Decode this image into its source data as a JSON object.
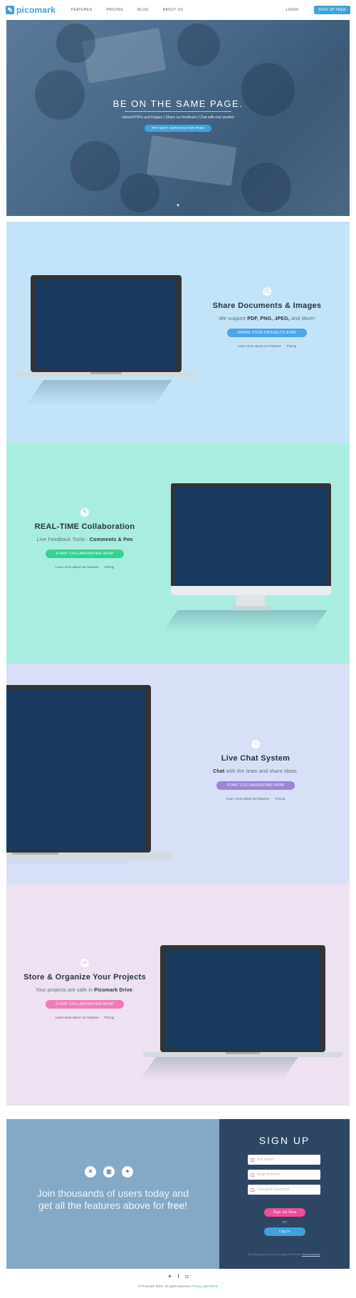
{
  "nav": {
    "logo_text": "picomark",
    "links": [
      "FEATURES",
      "PRICING",
      "BLOG",
      "ABOUT US"
    ],
    "login": "LOGIN",
    "signup": "SIGN UP FREE"
  },
  "hero": {
    "title": "BE ON THE SAME PAGE.",
    "subtitle": "Upload PDFs and Images | Share our feedback | Chat with one another",
    "button": "TRY BETA VERSION FOR FREE"
  },
  "sections": [
    {
      "title": "Share Documents & Images",
      "desc_prefix": "We support ",
      "desc_bold": "PDF, PNG, JPEG,",
      "desc_suffix": " and More!",
      "button": "SHARE YOUR PROJECTS NOW!",
      "button_color": "#4aa6e8",
      "link1": "Learn more about our features",
      "link2": "Pricing"
    },
    {
      "title": "REAL-TIME Collaboration",
      "desc_prefix": "Live Feedback Tools - ",
      "desc_bold": "Comments & Pen",
      "desc_suffix": "",
      "button": "START COLLABORATING NOW!",
      "button_color": "#35d190",
      "link1": "Learn more about our features",
      "link2": "Pricing"
    },
    {
      "title": "Live Chat System",
      "desc_prefix": "",
      "desc_bold": "Chat",
      "desc_suffix": " with the team and share ideas.",
      "button": "START COLLABORATING NOW!",
      "button_color": "#9b86d6",
      "link1": "Learn more about our features",
      "link2": "Pricing"
    },
    {
      "title": "Store & Organize Your Projects",
      "desc_prefix": "Your projects are safe in ",
      "desc_bold": "Picomark Drive",
      "desc_suffix": ".",
      "button": "START COLLABORATING NOW!",
      "button_color": "#f27ab8",
      "link1": "Learn more about our features",
      "link2": "Pricing"
    }
  ],
  "signup": {
    "join_line1": "Join thousands of users today and",
    "join_line2_prefix": "get all the features above for ",
    "join_line2_bold": "free",
    "join_line2_suffix": "!",
    "title": "SIGN UP",
    "full_name_placeholder": "Full Name",
    "email_placeholder": "Email Address",
    "password_placeholder": "Choose A Password",
    "signup_button": "Sign Up Now",
    "or": "OR",
    "login_button": "Log In",
    "terms_prefix": "By clicking Sign Up Now you agree to Picomark ",
    "terms_link": "Terms of Service"
  },
  "social_icons": [
    "close-icon",
    "book-icon",
    "bird-icon"
  ],
  "footer": {
    "icons": [
      "twitter-icon",
      "facebook-icon",
      "instagram-icon"
    ],
    "copyright_prefix": "© Picomark 2015. All rights reserved. ",
    "privacy": "Privacy",
    "and": " and ",
    "terms": "Terms"
  },
  "colors": {
    "brand": "#3e9fd8",
    "signup_pink": "#ef4c9b",
    "dark_panel": "#2d4664"
  }
}
